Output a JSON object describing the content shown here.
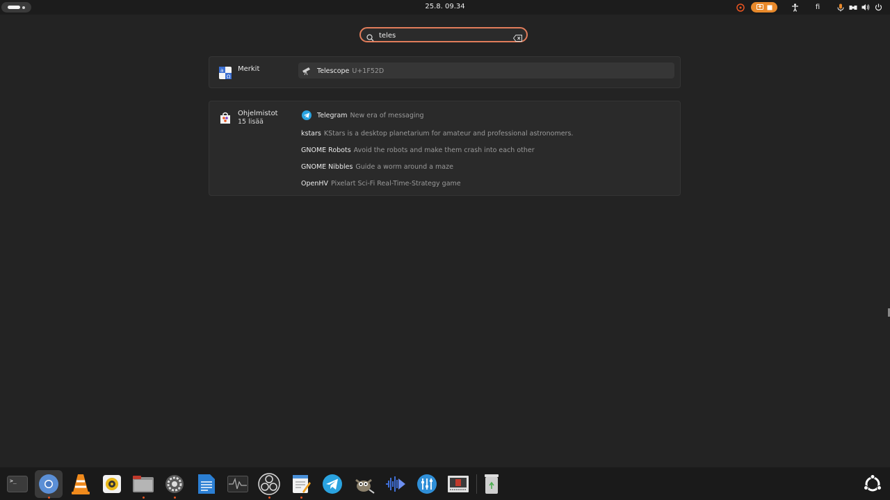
{
  "topbar": {
    "clock": "25.8.  09.34",
    "language": "fi"
  },
  "search": {
    "value": "teles",
    "placeholder": ""
  },
  "providers": [
    {
      "name": "Merkit",
      "sub": "",
      "icon": "characters-icon",
      "results": [
        {
          "name": "Telescope",
          "desc": "U+1F52D",
          "icon": "telescope-icon",
          "selected": true
        }
      ]
    },
    {
      "name": "Ohjelmistot",
      "sub": "15 lisää",
      "icon": "software-icon",
      "results": [
        {
          "name": "Telegram",
          "desc": "New era of messaging",
          "icon": "telegram-icon"
        },
        {
          "name": "kstars",
          "desc": "KStars is a desktop planetarium for amateur and professional astronomers.",
          "icon": ""
        },
        {
          "name": "GNOME Robots",
          "desc": "Avoid the robots and make them crash into each other",
          "icon": ""
        },
        {
          "name": "GNOME Nibbles",
          "desc": "Guide a worm around a maze",
          "icon": ""
        },
        {
          "name": "OpenHV",
          "desc": "Pixelart Sci-Fi Real-Time-Strategy game",
          "icon": ""
        }
      ]
    }
  ],
  "dock": {
    "apps": [
      {
        "name": "terminal-icon"
      },
      {
        "name": "chromium-icon",
        "active": true,
        "running": true
      },
      {
        "name": "vlc-icon"
      },
      {
        "name": "rhythmbox-icon"
      },
      {
        "name": "files-icon",
        "running": true
      },
      {
        "name": "settings-icon",
        "running": true
      },
      {
        "name": "libreoffice-writer-icon"
      },
      {
        "name": "system-monitor-icon"
      },
      {
        "name": "obs-icon",
        "running": true
      },
      {
        "name": "text-editor-icon",
        "running": true
      },
      {
        "name": "telegram-icon"
      },
      {
        "name": "gimp-icon"
      },
      {
        "name": "audio-editor-icon"
      },
      {
        "name": "equalizer-icon"
      },
      {
        "name": "terminal-emulator-icon"
      },
      {
        "name": "trash-icon"
      }
    ],
    "show_apps_icon": "ubuntu-logo-icon"
  },
  "colors": {
    "accent": "#e95420",
    "search_border": "#e27d5b",
    "panel_bg": "#2a2a2a",
    "background": "#232323"
  }
}
